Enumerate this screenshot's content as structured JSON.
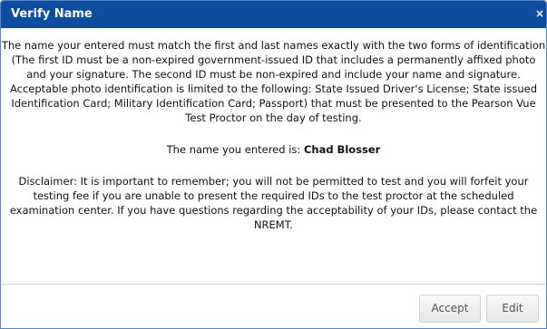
{
  "dialog": {
    "title": "Verify Name",
    "close_glyph": "×"
  },
  "body": {
    "intro": "The name your entered must match the first and last names exactly with the two forms of identification (The first ID must be a non-expired government-issued ID that includes a permanently affixed photo and your signature. The second ID must be non-expired and include your name and signature. Acceptable photo identification is limited to the following: State Issued Driver's License; State issued Identification Card; Military Identification Card; Passport) that must be presented to the Pearson Vue Test Proctor on the day of testing.",
    "name_prefix": "The name you entered is: ",
    "entered_name": "Chad Blosser",
    "disclaimer": "Disclaimer: It is important to remember; you will not be permitted to test and you will forfeit your testing fee if you are unable to present the required IDs to the test proctor at the scheduled examination center. If you have questions regarding the acceptability of your IDs, please contact the NREMT."
  },
  "buttons": {
    "accept_label": "Accept",
    "edit_label": "Edit"
  },
  "colors": {
    "titlebar": "#0d4c9f",
    "border": "#5b86c4"
  },
  "icons": {
    "close": "close-icon"
  }
}
